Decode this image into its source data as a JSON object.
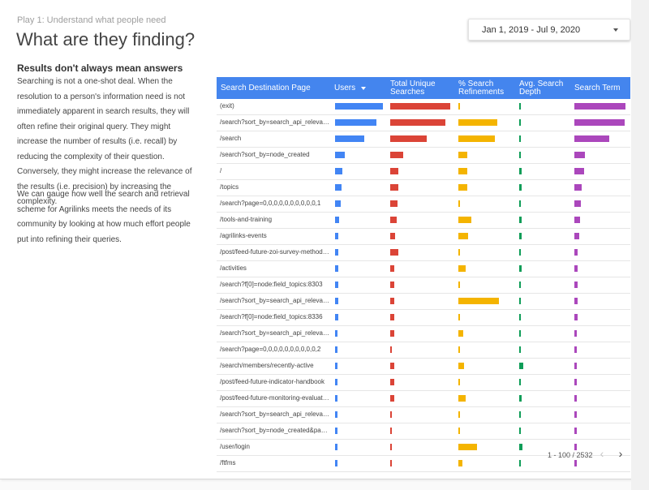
{
  "header": {
    "eyebrow": "Play 1: Understand what people need",
    "title": "What are they finding?"
  },
  "date_range": {
    "label": "Jan 1, 2019 - Jul 9, 2020",
    "icon": "caret-down-icon"
  },
  "sidebar": {
    "heading": "Results don't always mean answers",
    "paragraph1": "Searching is not a one-shot deal. When the resolution to a person's information need is not immediately apparent in search results, they will often refine their original query. They might increase the number of results (i.e. recall) by reducing the complexity of their question. Conversely, they might increase the relevance of the results (i.e. precision) by increasing the complexity.",
    "paragraph2": "We can gauge how well the search and retrieval scheme for Agrilinks meets the needs of its community by looking at how much effort people put into refining their queries."
  },
  "table": {
    "columns": [
      {
        "label": "Search Destination Page"
      },
      {
        "label": "Users",
        "sorted": true
      },
      {
        "label": "Total Unique Searches"
      },
      {
        "label": "% Search Refinements"
      },
      {
        "label": "Avg. Search Depth"
      },
      {
        "label": "Search Term"
      }
    ],
    "bar_colors": [
      "#4285f4",
      "#db4437",
      "#f4b400",
      "#0f9d58",
      "#ab47bc"
    ],
    "rows": [
      {
        "page": "(exit)",
        "values": [
          1.0,
          1.0,
          0.04,
          0.02,
          1.0
        ]
      },
      {
        "page": "/search?sort_by=search_api_relevance...",
        "values": [
          0.86,
          0.92,
          0.82,
          0.02,
          0.98
        ]
      },
      {
        "page": "/search",
        "values": [
          0.61,
          0.61,
          0.78,
          0.02,
          0.69
        ]
      },
      {
        "page": "/search?sort_by=node_created",
        "values": [
          0.21,
          0.22,
          0.19,
          0.02,
          0.21
        ]
      },
      {
        "page": "/",
        "values": [
          0.16,
          0.13,
          0.19,
          0.25,
          0.19
        ]
      },
      {
        "page": "/topics",
        "values": [
          0.13,
          0.13,
          0.19,
          0.23,
          0.15
        ]
      },
      {
        "page": "/search?page=0,0,0,0,0,0,0,0,0,0,1",
        "values": [
          0.12,
          0.12,
          0.03,
          0.02,
          0.13
        ]
      },
      {
        "page": "/tools-and-training",
        "values": [
          0.09,
          0.11,
          0.28,
          0.23,
          0.11
        ]
      },
      {
        "page": "/agrilinks-events",
        "values": [
          0.06,
          0.08,
          0.21,
          0.25,
          0.09
        ]
      },
      {
        "page": "/post/feed-future-zoi-survey-methodology",
        "values": [
          0.06,
          0.13,
          0.04,
          0.06,
          0.06
        ]
      },
      {
        "page": "/activities",
        "values": [
          0.06,
          0.07,
          0.16,
          0.23,
          0.06
        ]
      },
      {
        "page": "/search?f[0]=node:field_topics:8303",
        "values": [
          0.06,
          0.07,
          0.04,
          0.02,
          0.06
        ]
      },
      {
        "page": "/search?sort_by=search_api_relevance...",
        "values": [
          0.06,
          0.07,
          0.86,
          0.02,
          0.06
        ]
      },
      {
        "page": "/search?f[0]=node:field_topics:8336",
        "values": [
          0.06,
          0.07,
          0.03,
          0.02,
          0.06
        ]
      },
      {
        "page": "/search?sort_by=search_api_relevance...",
        "values": [
          0.05,
          0.07,
          0.1,
          0.02,
          0.05
        ]
      },
      {
        "page": "/search?page=0,0,0,0,0,0,0,0,0,0,2",
        "values": [
          0.05,
          0.03,
          0.03,
          0.02,
          0.05
        ]
      },
      {
        "page": "/search/members/recently-active",
        "values": [
          0.05,
          0.07,
          0.12,
          0.38,
          0.05
        ]
      },
      {
        "page": "/post/feed-future-indicator-handbook",
        "values": [
          0.05,
          0.07,
          0.03,
          0.02,
          0.05
        ]
      },
      {
        "page": "/post/feed-future-monitoring-evaluation",
        "values": [
          0.05,
          0.07,
          0.16,
          0.23,
          0.05
        ]
      },
      {
        "page": "/search?sort_by=search_api_relevance...",
        "values": [
          0.05,
          0.03,
          0.03,
          0.02,
          0.05
        ]
      },
      {
        "page": "/search?sort_by=node_created&page=1",
        "values": [
          0.05,
          0.03,
          0.03,
          0.02,
          0.05
        ]
      },
      {
        "page": "/user/login",
        "values": [
          0.04,
          0.03,
          0.39,
          0.3,
          0.04
        ]
      },
      {
        "page": "/ftfms",
        "values": [
          0.04,
          0.03,
          0.08,
          0.02,
          0.04
        ]
      }
    ],
    "pagination": {
      "label": "1 - 100 / 2532",
      "prev_icon": "chevron-left-icon",
      "next_icon": "chevron-right-icon"
    }
  }
}
